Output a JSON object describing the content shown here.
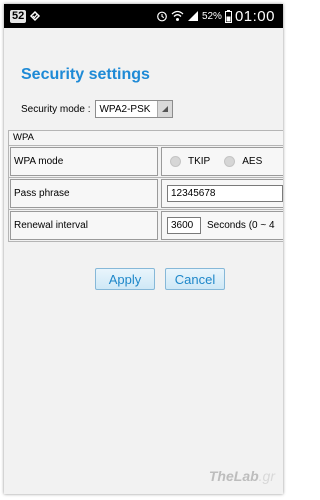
{
  "status_bar": {
    "notification_count": "52",
    "battery_text": "52%",
    "time": "01:00",
    "icons": [
      "check-icon",
      "clock-icon",
      "wifi-icon",
      "signal-icon",
      "battery-icon"
    ]
  },
  "page": {
    "title": "Security settings",
    "security_mode_label": "Security mode :",
    "security_mode_value": "WPA2-PSK"
  },
  "wpa": {
    "header": "WPA",
    "mode_label": "WPA mode",
    "mode_options": [
      "TKIP",
      "AES"
    ],
    "pass_label": "Pass phrase",
    "pass_value": "12345678",
    "renewal_label": "Renewal interval",
    "renewal_value": "3600",
    "renewal_unit": "Seconds (0 ~ 4"
  },
  "buttons": {
    "apply": "Apply",
    "cancel": "Cancel"
  },
  "watermark": {
    "brand": "TheLab",
    "suffix": ".gr"
  },
  "colors": {
    "title": "#1e8ad6",
    "button_text": "#1e87c9"
  }
}
